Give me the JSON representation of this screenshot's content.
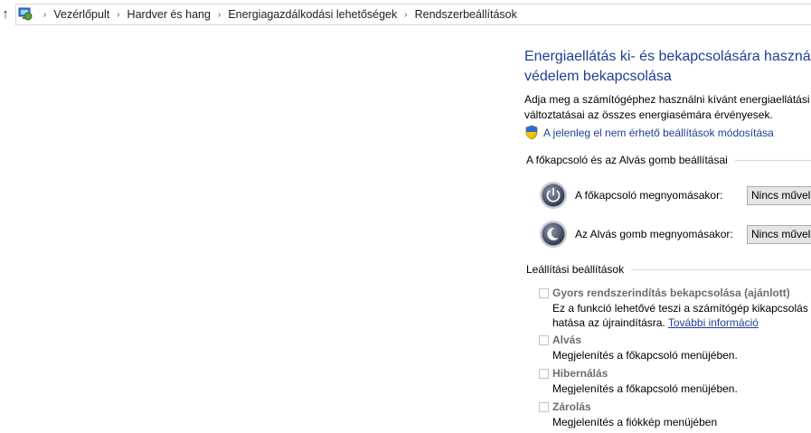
{
  "address_bar": {
    "crumbs": [
      "Vezérlőpult",
      "Hardver és hang",
      "Energiagazdálkodási lehetőségek",
      "Rendszerbeállítások"
    ]
  },
  "content": {
    "title_line1": "Energiaellátás ki- és bekapcsolására használt g",
    "title_line2": "védelem bekapcsolása",
    "desc_line1": "Adja meg a számítógéphez használni kívánt energiaellátási be",
    "desc_line2": "változtatásai az összes energiasémára érvényesek.",
    "change_link": "A jelenleg el nem érhető beállítások módosítása"
  },
  "power_buttons": {
    "heading": "A főkapcsoló és az Alvás gomb beállításai",
    "power_label": "A főkapcsoló megnyomásakor:",
    "power_value": "Nincs művele",
    "sleep_label": "Az Alvás gomb megnyomásakor:",
    "sleep_value": "Nincs művele"
  },
  "shutdown": {
    "heading": "Leállítási beállítások",
    "fast_startup_title": "Gyors rendszerindítás bekapcsolása (ajánlott)",
    "fast_startup_desc1": "Ez a funkció lehetővé teszi a számítógép kikapcsolás ut",
    "fast_startup_desc2": "hatása az újraindításra.",
    "more_info": "További információ",
    "sleep_title": "Alvás",
    "sleep_desc": "Megjelenítés a főkapcsoló menüjében.",
    "hibernate_title": "Hibernálás",
    "hibernate_desc": "Megjelenítés a főkapcsoló menüjében.",
    "lock_title": "Zárolás",
    "lock_desc": "Megjelenítés a fiókkép menüjében"
  }
}
